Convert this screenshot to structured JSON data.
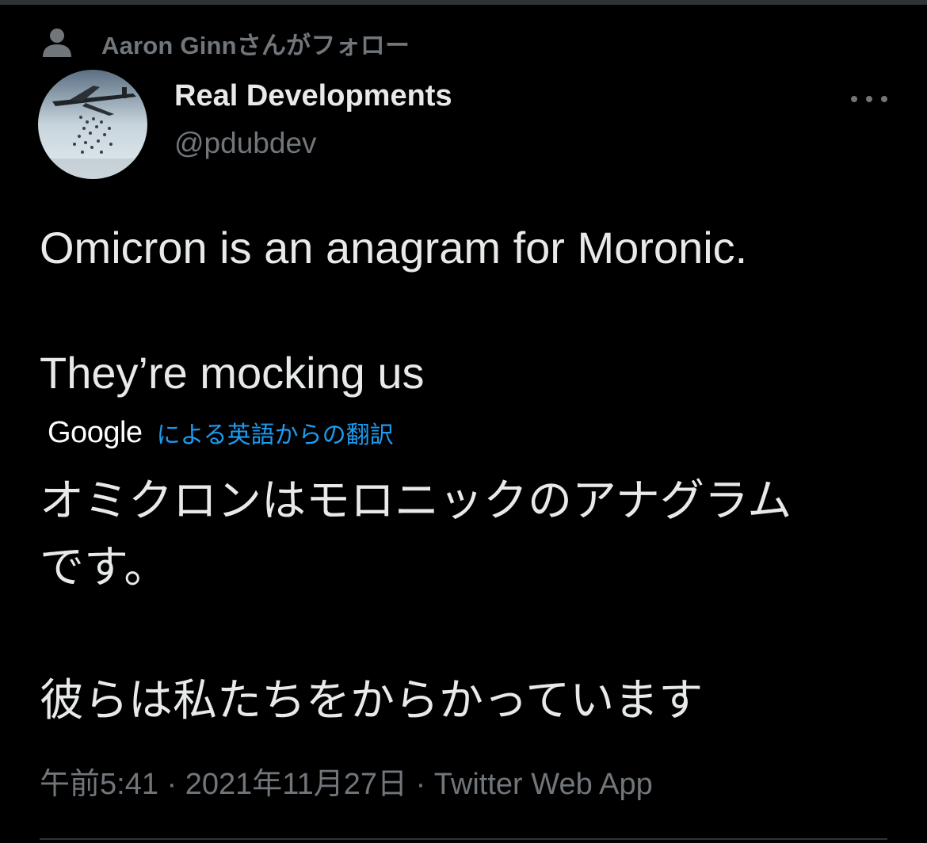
{
  "social_context": {
    "text": "Aaron Ginnさんがフォロー",
    "icon": "person-icon"
  },
  "tweet": {
    "author": {
      "display_name": "Real Developments",
      "handle": "@pdubdev"
    },
    "more_icon": "more-horizontal-icon",
    "text_lines": [
      "Omicron is an anagram for Moronic.",
      "They’re mocking us"
    ],
    "translation": {
      "provider": "Google",
      "label": "による英語からの翻訳",
      "text_lines": [
        "オミクロンはモロニックのアナグラム",
        "です。",
        "彼らは私たちをからかっています"
      ]
    },
    "meta": {
      "time": "午前5:41",
      "separator": " · ",
      "date": "2021年11月27日",
      "source": "Twitter Web App"
    }
  },
  "colors": {
    "background": "#000000",
    "text_primary": "#e7e9ea",
    "text_secondary": "#71767b",
    "link": "#1d9bf0",
    "divider": "#2f3336"
  }
}
